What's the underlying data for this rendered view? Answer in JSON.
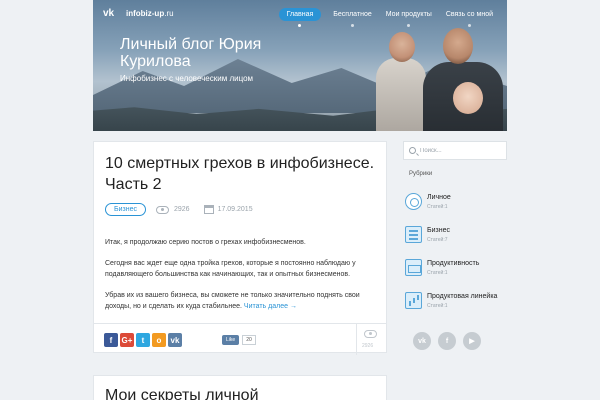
{
  "header": {
    "vk_logo": "vk",
    "site_name_bold": "infobiz-up",
    "site_name_suffix": ".ru",
    "nav": [
      "Главная",
      "Бесплатное",
      "Мои продукты",
      "Связь со мной"
    ],
    "blog_title": "Личный блог Юрия Курилова",
    "blog_subtitle": "Инфобизнес с человеческим лицом"
  },
  "post": {
    "title": "10 смертных грехов в инфобизнесе. Часть 2",
    "tag": "Бизнес",
    "views": "2926",
    "date": "17.09.2015",
    "paragraphs": [
      "Итак, я продолжаю серию постов о грехах инфобизнесменов.",
      "Сегодня вас ждет еще одна тройка грехов, которые я постоянно наблюдаю у подавляющего большинства как начинающих, так и опытных бизнесменов.",
      "Убрав их из вашего бизнеса, вы сможете не только значительно поднять свои доходы, но и сделать их куда стабильнее."
    ],
    "read_more": "Читать далее →",
    "share_icons": [
      "facebook-icon",
      "google-plus-icon",
      "twitter-icon",
      "odnoklassniki-icon",
      "vk-icon"
    ],
    "share_glyphs": [
      "f",
      "G+",
      "t",
      "о",
      "vk"
    ],
    "share_colors": [
      "#3b5998",
      "#dc4a38",
      "#2ea7e0",
      "#f29a21",
      "#5b7fa6"
    ],
    "like_label": "Like",
    "like_count": "20",
    "footer_views": "2926"
  },
  "post2": {
    "title": "Мои секреты личной"
  },
  "sidebar": {
    "search_placeholder": "Поиск...",
    "heading": "Рубрики",
    "categories": [
      {
        "name": "Личное",
        "count": "Статей:1"
      },
      {
        "name": "Бизнес",
        "count": "Статей:7"
      },
      {
        "name": "Продуктивность",
        "count": "Статей:1"
      },
      {
        "name": "Продуктовая линейка",
        "count": "Статей:1"
      }
    ],
    "social_glyphs": [
      "vk",
      "f",
      "▶"
    ]
  },
  "colors": {
    "accent": "#2a93d5",
    "background": "#eef1f4"
  }
}
